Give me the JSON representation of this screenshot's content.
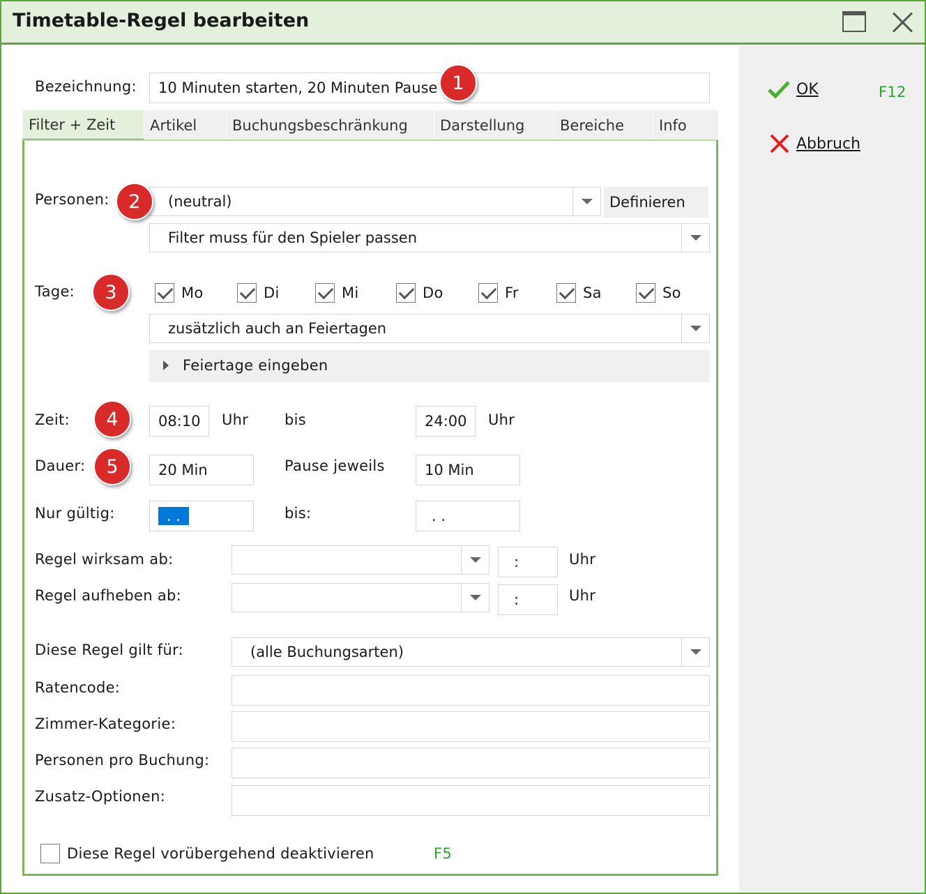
{
  "window": {
    "title": "Timetable-Regel bearbeiten"
  },
  "side": {
    "ok_label": "OK",
    "ok_key": "F12",
    "cancel_label": "Abbruch"
  },
  "bezeichnung": {
    "label": "Bezeichnung:",
    "value": "10 Minuten starten, 20 Minuten Pause"
  },
  "tabs": [
    "Filter + Zeit",
    "Artikel",
    "Buchungsbeschränkung",
    "Darstellung",
    "Bereiche",
    "Info"
  ],
  "markers": [
    "1",
    "2",
    "3",
    "4",
    "5"
  ],
  "personen": {
    "label": "Personen:",
    "value": "(neutral)",
    "define_label": "Definieren",
    "filter_value": "Filter muss für den Spieler passen"
  },
  "tage": {
    "label": "Tage:",
    "days": [
      {
        "label": "Mo",
        "checked": true
      },
      {
        "label": "Di",
        "checked": true
      },
      {
        "label": "Mi",
        "checked": true
      },
      {
        "label": "Do",
        "checked": true
      },
      {
        "label": "Fr",
        "checked": true
      },
      {
        "label": "Sa",
        "checked": true
      },
      {
        "label": "So",
        "checked": true
      }
    ],
    "holiday_value": "zusätzlich auch an Feiertagen",
    "holiday_expander": "Feiertage eingeben"
  },
  "zeit": {
    "label": "Zeit:",
    "from": "08:10",
    "unit": "Uhr",
    "bis": "bis",
    "to": "24:00"
  },
  "dauer": {
    "label": "Dauer:",
    "value": "20 Min",
    "pause_label": "Pause jeweils",
    "pause_value": "10 Min"
  },
  "gueltig": {
    "label": "Nur gültig:",
    "from": ". .",
    "bis": "bis:",
    "to": ". ."
  },
  "wirksam": {
    "label": "Regel wirksam ab:",
    "date": "",
    "time": ":",
    "unit": "Uhr"
  },
  "aufheben": {
    "label": "Regel aufheben ab:",
    "date": "",
    "time": ":",
    "unit": "Uhr"
  },
  "gilt": {
    "label": "Diese Regel gilt für:",
    "value": "(alle Buchungsarten)"
  },
  "ratencode": {
    "label": "Ratencode:",
    "value": ""
  },
  "zimmer": {
    "label": "Zimmer-Kategorie:",
    "value": ""
  },
  "personen_buchung": {
    "label": "Personen pro Buchung:",
    "value": ""
  },
  "zusatz": {
    "label": "Zusatz-Optionen:",
    "value": ""
  },
  "deaktivieren": {
    "label": "Diese Regel vorübergehend deaktivieren",
    "key": "F5",
    "checked": false
  },
  "colors": {
    "accent": "#5aa83a",
    "title_bg": "#e3f1dc",
    "marker": "#d92a2a",
    "selection": "#0078d7"
  }
}
